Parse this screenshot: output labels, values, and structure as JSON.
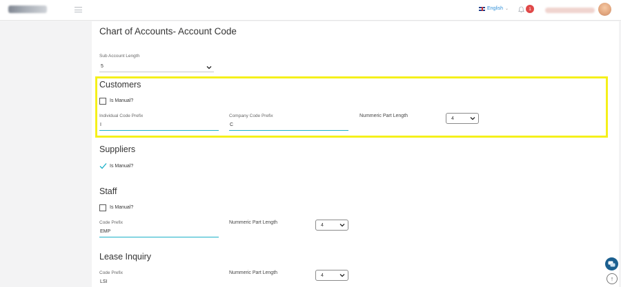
{
  "header": {
    "language": "English",
    "notification_count": "1"
  },
  "page": {
    "title": "Chart of Accounts- Account Code",
    "sub_account_length_label": "Sub Account Length",
    "sub_account_length_value": "5"
  },
  "customers": {
    "title": "Customers",
    "is_manual_label": "Is Manual?",
    "is_manual": false,
    "individual_prefix_label": "Individual Code Prefix",
    "individual_prefix_value": "I",
    "company_prefix_label": "Company Code Prefix",
    "company_prefix_value": "C",
    "numeric_length_label": "Nummeric Part Length",
    "numeric_length_value": "4"
  },
  "suppliers": {
    "title": "Suppliers",
    "is_manual_label": "Is Manual?",
    "is_manual": true
  },
  "staff": {
    "title": "Staff",
    "is_manual_label": "Is Manual?",
    "is_manual": false,
    "code_prefix_label": "Code Prefix",
    "code_prefix_value": "EMP",
    "numeric_length_label": "Nummeric Part Length",
    "numeric_length_value": "4"
  },
  "lease_inquiry": {
    "title": "Lease Inquiry",
    "code_prefix_label": "Code Prefix",
    "code_prefix_value": "LSI",
    "numeric_length_label": "Nummeric Part Length",
    "numeric_length_value": "4"
  },
  "colors": {
    "accent": "#19b0c8",
    "highlight": "#f5f01a",
    "badge": "#e04848",
    "chat_button": "#1b5f8f"
  },
  "icons": [
    "menu-icon",
    "uk-flag-icon",
    "bell-icon",
    "chevron-down-icon",
    "check-icon",
    "chat-icon",
    "arrow-up-icon"
  ]
}
